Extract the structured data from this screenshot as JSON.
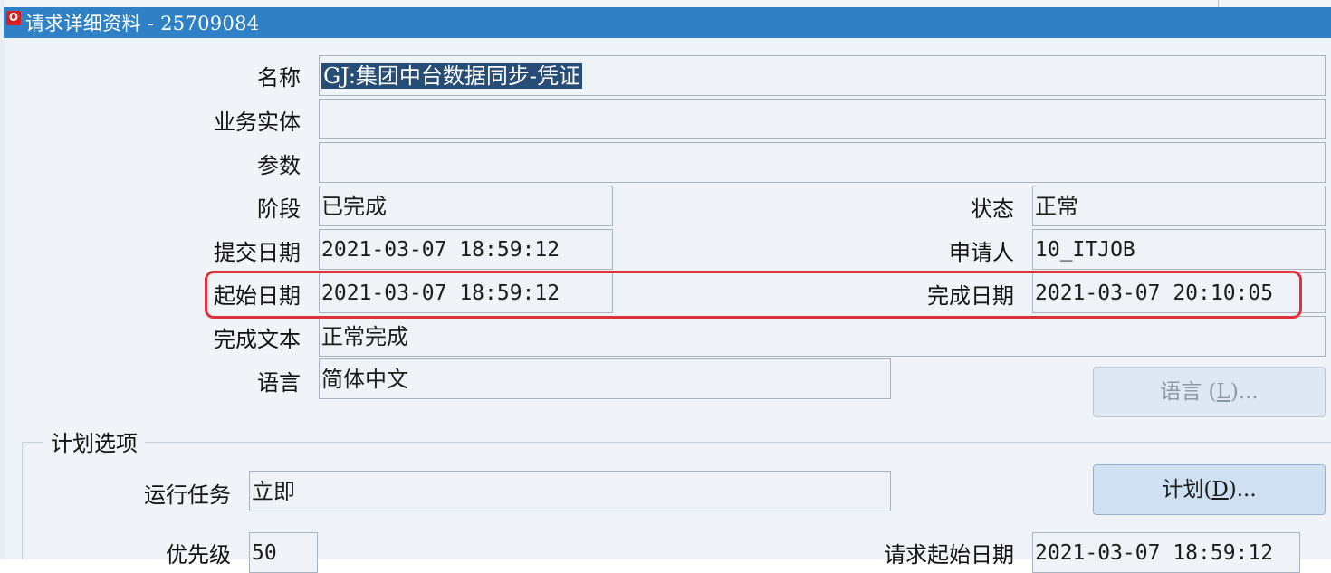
{
  "window": {
    "title": "请求详细资料 - 25709084",
    "icon": "oracle-window-icon",
    "icon_text": "O"
  },
  "fields": {
    "name": {
      "label": "名称",
      "value": "GJ:集团中台数据同步-凭证"
    },
    "entity": {
      "label": "业务实体",
      "value": ""
    },
    "params": {
      "label": "参数",
      "value": ""
    },
    "phase": {
      "label": "阶段",
      "value": "已完成"
    },
    "status": {
      "label": "状态",
      "value": "正常"
    },
    "submit_date": {
      "label": "提交日期",
      "value": "2021-03-07 18:59:12"
    },
    "requester": {
      "label": "申请人",
      "value": "10_ITJOB"
    },
    "start_date": {
      "label": "起始日期",
      "value": "2021-03-07 18:59:12"
    },
    "completion_date": {
      "label": "完成日期",
      "value": "2021-03-07 20:10:05"
    },
    "completion_text": {
      "label": "完成文本",
      "value": "正常完成"
    },
    "language": {
      "label": "语言",
      "value": "简体中文"
    }
  },
  "buttons": {
    "language": {
      "label_pre": "语言 (",
      "mnemonic": "L",
      "label_post": ")..."
    },
    "schedule": {
      "label_pre": "计划(",
      "mnemonic": "D",
      "label_post": ")..."
    }
  },
  "schedule_group": {
    "title": "计划选项",
    "run_task": {
      "label": "运行任务",
      "value": "立即"
    },
    "priority": {
      "label": "优先级",
      "value": "50"
    },
    "request_start_date": {
      "label": "请求起始日期",
      "value": "2021-03-07 18:59:12"
    }
  },
  "highlight": {
    "color": "#e0323d"
  }
}
